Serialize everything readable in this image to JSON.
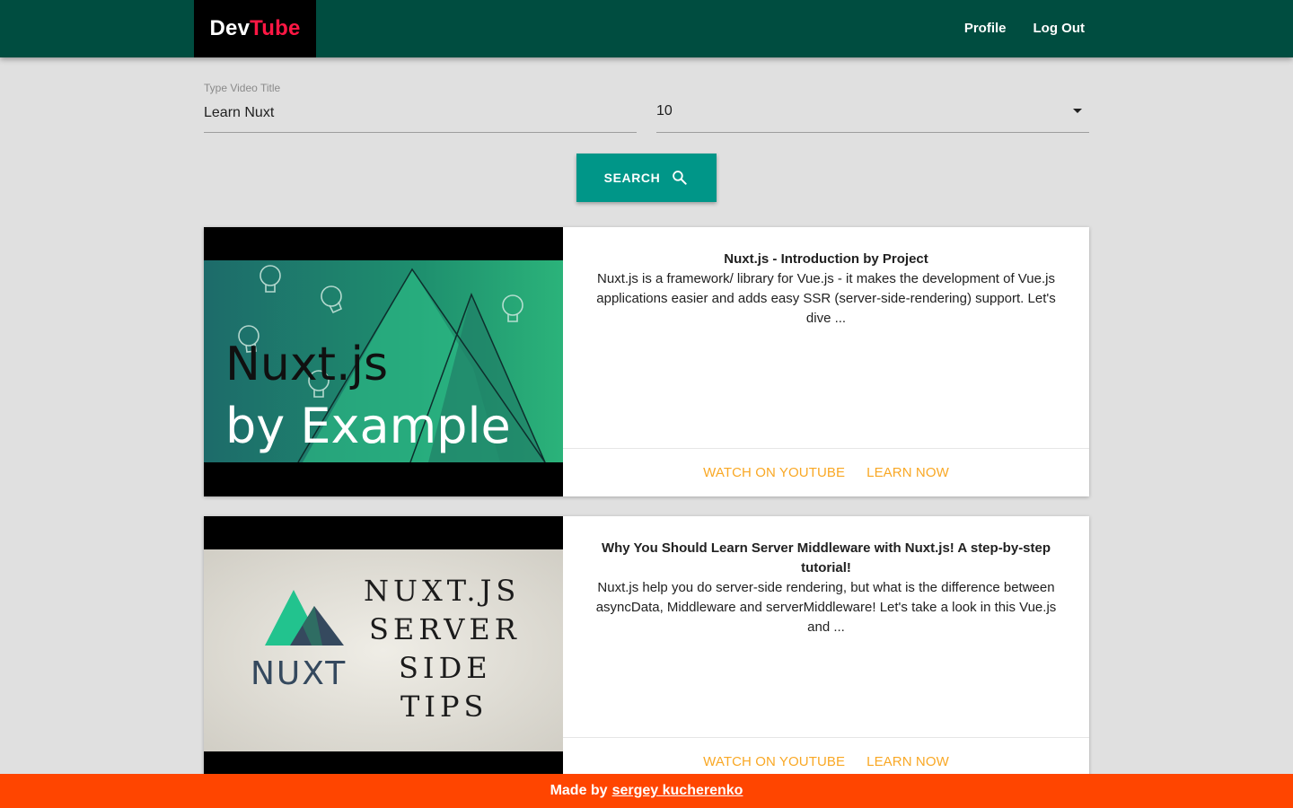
{
  "header": {
    "logo_dev": "Dev",
    "logo_tube": "Tube",
    "nav": [
      "Profile",
      "Log Out"
    ]
  },
  "search": {
    "title_label": "Type Video Title",
    "title_value": "Learn Nuxt",
    "count_value": "10",
    "button_label": "SEARCH"
  },
  "videos": [
    {
      "title": "Nuxt.js - Introduction by Project",
      "description": "Nuxt.js is a framework/ library for Vue.js - it makes the development of Vue.js applications easier and adds easy SSR (server-side-rendering) support. Let's dive ...",
      "thumb_line1": "Nuxt.js",
      "thumb_line2": "by Example",
      "watch_label": "WATCH ON YOUTUBE",
      "learn_label": "LEARN NOW"
    },
    {
      "title": "Why You Should Learn Server Middleware with Nuxt.js! A step-by-step tutorial!",
      "description": "Nuxt.js help you do server-side rendering, but what is the difference between asyncData, Middleware and serverMiddleware! Let's take a look in this Vue.js and ...",
      "thumb_brand": "NUXT",
      "thumb_lines": [
        "NUXT.JS",
        "SERVER",
        "SIDE",
        "TIPS"
      ],
      "watch_label": "WATCH ON YOUTUBE",
      "learn_label": "LEARN NOW"
    }
  ],
  "footer": {
    "prefix": "Made by",
    "author": "sergey kucherenko"
  },
  "colors": {
    "header_bg": "#004d40",
    "accent_red": "#ff1744",
    "button_teal": "#009688",
    "link_amber": "#f9a825",
    "footer_bg": "#ff4500"
  }
}
